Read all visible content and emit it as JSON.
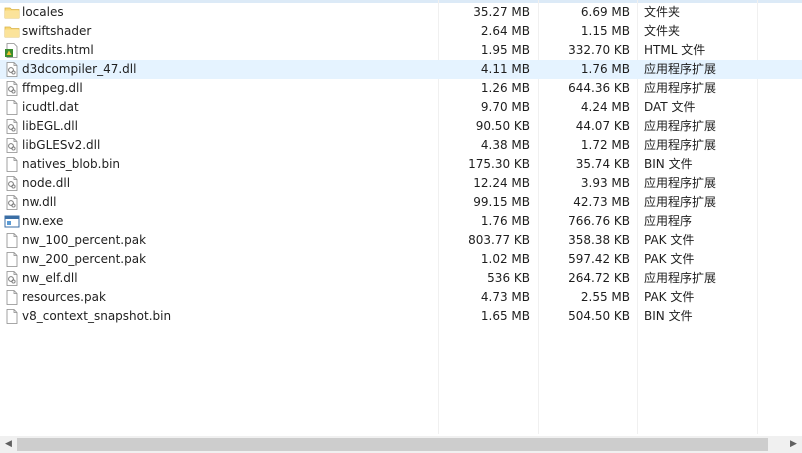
{
  "files": [
    {
      "name": "locales",
      "size": "35.27 MB",
      "compressed": "6.69 MB",
      "type": "文件夹",
      "icon": "folder-icon"
    },
    {
      "name": "swiftshader",
      "size": "2.64 MB",
      "compressed": "1.15 MB",
      "type": "文件夹",
      "icon": "folder-icon"
    },
    {
      "name": "credits.html",
      "size": "1.95 MB",
      "compressed": "332.70 KB",
      "type": "HTML 文件",
      "icon": "html-file-icon"
    },
    {
      "name": "d3dcompiler_47.dll",
      "size": "4.11 MB",
      "compressed": "1.76 MB",
      "type": "应用程序扩展",
      "icon": "dll-file-icon"
    },
    {
      "name": "ffmpeg.dll",
      "size": "1.26 MB",
      "compressed": "644.36 KB",
      "type": "应用程序扩展",
      "icon": "dll-file-icon"
    },
    {
      "name": "icudtl.dat",
      "size": "9.70 MB",
      "compressed": "4.24 MB",
      "type": "DAT 文件",
      "icon": "file-icon"
    },
    {
      "name": "libEGL.dll",
      "size": "90.50 KB",
      "compressed": "44.07 KB",
      "type": "应用程序扩展",
      "icon": "dll-file-icon"
    },
    {
      "name": "libGLESv2.dll",
      "size": "4.38 MB",
      "compressed": "1.72 MB",
      "type": "应用程序扩展",
      "icon": "dll-file-icon"
    },
    {
      "name": "natives_blob.bin",
      "size": "175.30 KB",
      "compressed": "35.74 KB",
      "type": "BIN 文件",
      "icon": "file-icon"
    },
    {
      "name": "node.dll",
      "size": "12.24 MB",
      "compressed": "3.93 MB",
      "type": "应用程序扩展",
      "icon": "dll-file-icon"
    },
    {
      "name": "nw.dll",
      "size": "99.15 MB",
      "compressed": "42.73 MB",
      "type": "应用程序扩展",
      "icon": "dll-file-icon"
    },
    {
      "name": "nw.exe",
      "size": "1.76 MB",
      "compressed": "766.76 KB",
      "type": "应用程序",
      "icon": "exe-file-icon"
    },
    {
      "name": "nw_100_percent.pak",
      "size": "803.77 KB",
      "compressed": "358.38 KB",
      "type": "PAK 文件",
      "icon": "file-icon"
    },
    {
      "name": "nw_200_percent.pak",
      "size": "1.02 MB",
      "compressed": "597.42 KB",
      "type": "PAK 文件",
      "icon": "file-icon"
    },
    {
      "name": "nw_elf.dll",
      "size": "536 KB",
      "compressed": "264.72 KB",
      "type": "应用程序扩展",
      "icon": "dll-file-icon"
    },
    {
      "name": "resources.pak",
      "size": "4.73 MB",
      "compressed": "2.55 MB",
      "type": "PAK 文件",
      "icon": "file-icon"
    },
    {
      "name": "v8_context_snapshot.bin",
      "size": "1.65 MB",
      "compressed": "504.50 KB",
      "type": "BIN 文件",
      "icon": "file-icon"
    }
  ],
  "selected_index": 3,
  "colors": {
    "selection": "#e5f3ff",
    "folder": "#f8d775",
    "scrollbar_track": "#f0f0f0",
    "scrollbar_thumb": "#cdcdcd"
  },
  "scrollbar": {
    "left_arrow": "◀",
    "right_arrow": "▶"
  }
}
